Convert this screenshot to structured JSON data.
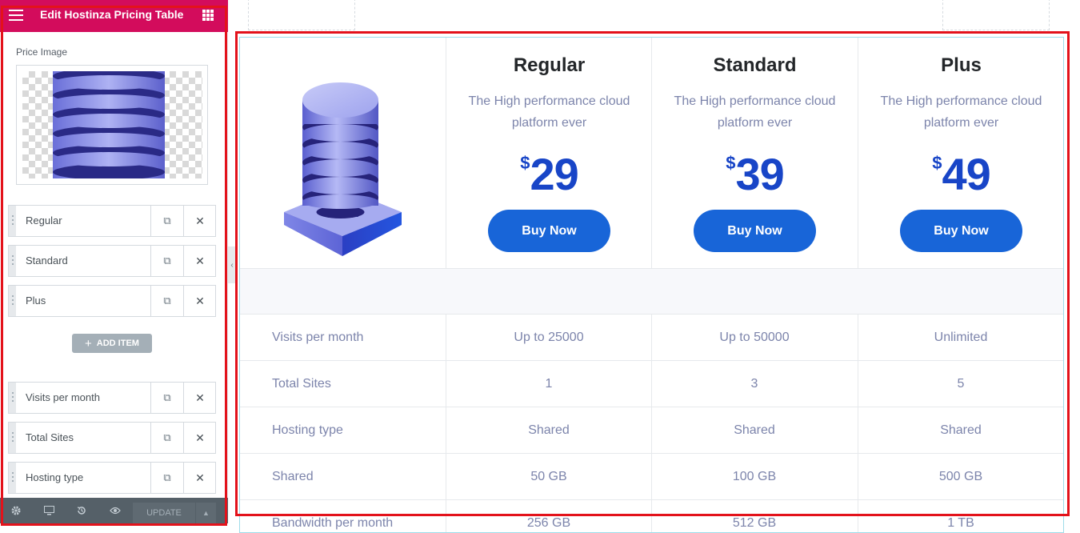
{
  "panel": {
    "title": "Edit Hostinza Pricing Table",
    "price_image_label": "Price Image",
    "plan_items": [
      {
        "label": "Regular"
      },
      {
        "label": "Standard"
      },
      {
        "label": "Plus"
      }
    ],
    "add_item_label": "ADD ITEM",
    "feature_items": [
      {
        "label": "Visits per month"
      },
      {
        "label": "Total Sites"
      },
      {
        "label": "Hosting type"
      }
    ],
    "footer": {
      "update_label": "UPDATE",
      "icons": [
        "settings-icon",
        "responsive-icon",
        "history-icon",
        "preview-icon"
      ]
    }
  },
  "pricing": {
    "plans": [
      {
        "name": "Regular",
        "description": "The High performance cloud platform ever",
        "currency": "$",
        "price": "29",
        "button": "Buy Now"
      },
      {
        "name": "Standard",
        "description": "The High performance cloud platform ever",
        "currency": "$",
        "price": "39",
        "button": "Buy Now"
      },
      {
        "name": "Plus",
        "description": "The High performance cloud platform ever",
        "currency": "$",
        "price": "49",
        "button": "Buy Now"
      }
    ],
    "features": [
      {
        "label": "Visits per month",
        "values": [
          "Up to 25000",
          "Up to 50000",
          "Unlimited"
        ]
      },
      {
        "label": "Total Sites",
        "values": [
          "1",
          "3",
          "5"
        ]
      },
      {
        "label": "Hosting type",
        "values": [
          "Shared",
          "Shared",
          "Shared"
        ]
      },
      {
        "label": "Shared",
        "values": [
          "50 GB",
          "100 GB",
          "500 GB"
        ]
      },
      {
        "label": "Bandwidth per month",
        "values": [
          "256 GB",
          "512 GB",
          "1 TB"
        ]
      }
    ]
  },
  "colors": {
    "panel_header": "#d30c5c",
    "price_text": "#1845c7",
    "button_bg": "#1865d8",
    "highlight_frame": "#e3121b"
  }
}
